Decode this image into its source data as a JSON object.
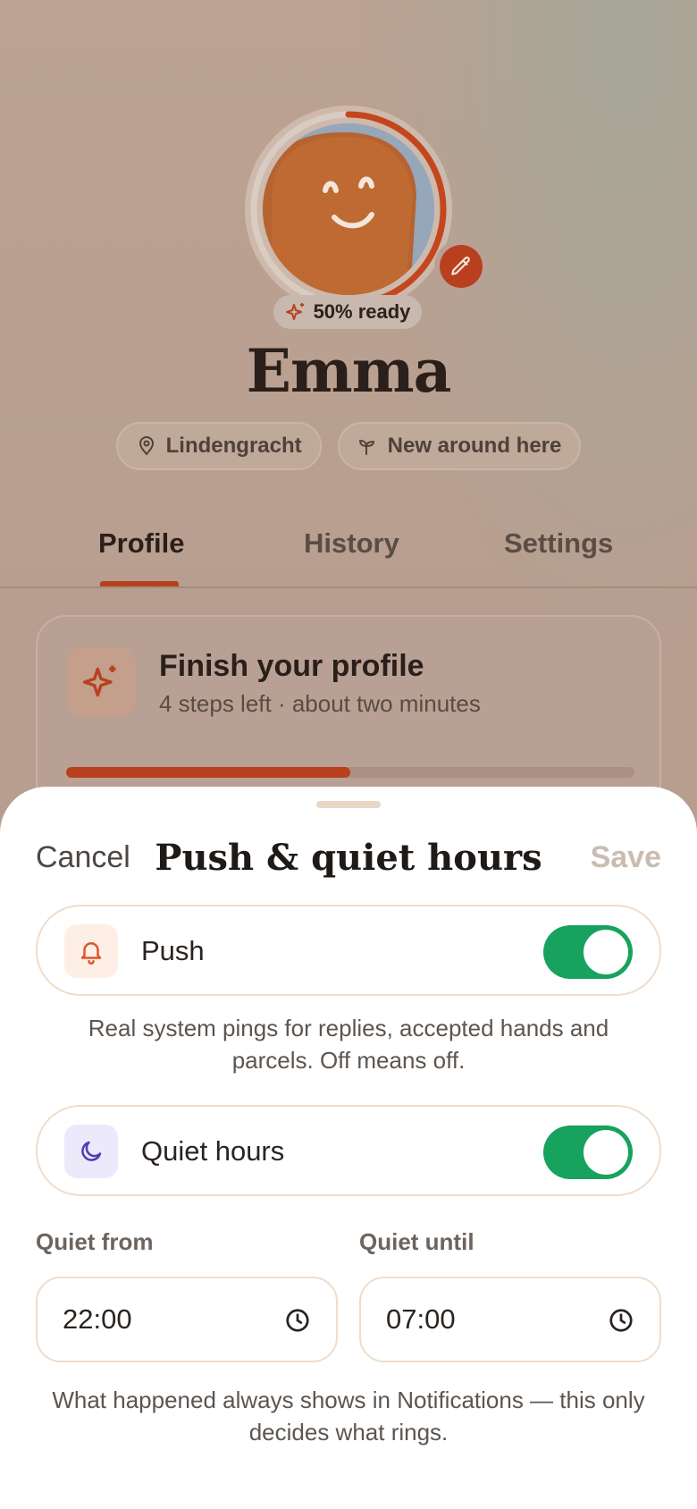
{
  "profile": {
    "ready_label": "50% ready",
    "ready_progress": 0.5,
    "name": "Emma",
    "chips": [
      {
        "icon": "map-pin-icon",
        "label": "Lindengracht"
      },
      {
        "icon": "sprout-icon",
        "label": "New around here"
      }
    ]
  },
  "tabs": [
    {
      "label": "Profile",
      "active": true
    },
    {
      "label": "History",
      "active": false
    },
    {
      "label": "Settings",
      "active": false
    }
  ],
  "finish_card": {
    "icon": "sparkle-icon",
    "title": "Finish your profile",
    "subtitle": "4 steps left · about two minutes",
    "progress": 0.5
  },
  "sheet": {
    "cancel_label": "Cancel",
    "title": "Push & quiet hours",
    "save_label": "Save",
    "push": {
      "icon": "bell-icon",
      "label": "Push",
      "enabled": true
    },
    "push_note": "Real system pings for replies, accepted hands and parcels. Off means off.",
    "quiet": {
      "icon": "moon-icon",
      "label": "Quiet hours",
      "enabled": true
    },
    "quiet_from": {
      "label": "Quiet from",
      "value": "22:00"
    },
    "quiet_until": {
      "label": "Quiet until",
      "value": "07:00"
    },
    "footer_note": "What happened always shows in Notifications — this only decides what rings."
  },
  "colors": {
    "accent": "#b8401e",
    "toggle_on": "#17a35e",
    "overlay_bg": "#b79e8f",
    "sheet_bg": "#ffffff"
  }
}
